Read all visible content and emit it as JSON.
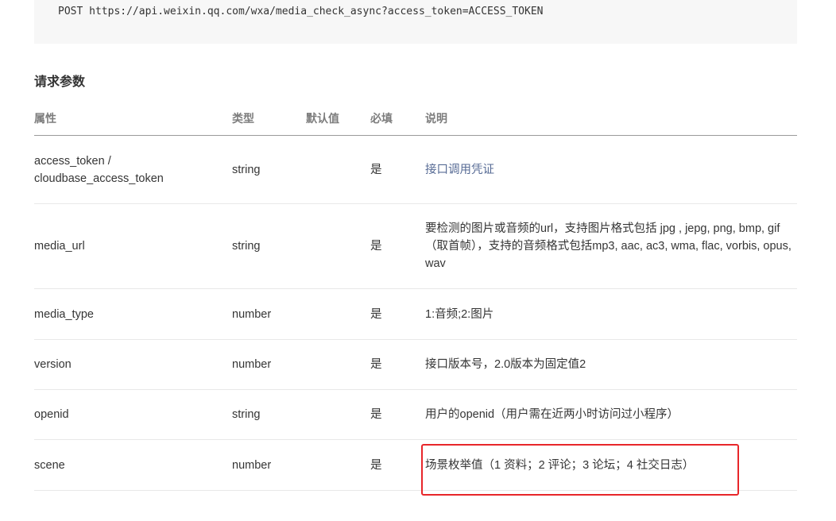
{
  "code": {
    "request_line": "POST https://api.weixin.qq.com/wxa/media_check_async?access_token=ACCESS_TOKEN"
  },
  "section": {
    "title": "请求参数"
  },
  "table": {
    "headers": {
      "name": "属性",
      "type": "类型",
      "default": "默认值",
      "required": "必填",
      "desc": "说明"
    },
    "rows": [
      {
        "name_line1": "access_token /",
        "name_line2": "cloudbase_access_token",
        "type": "string",
        "default": "",
        "required": "是",
        "desc": "接口调用凭证"
      },
      {
        "name": "media_url",
        "type": "string",
        "default": "",
        "required": "是",
        "desc": "要检测的图片或音频的url，支持图片格式包括 jpg , jepg, png, bmp, gif（取首帧），支持的音频格式包括mp3, aac, ac3, wma, flac, vorbis, opus, wav"
      },
      {
        "name": "media_type",
        "type": "number",
        "default": "",
        "required": "是",
        "desc": "1:音频;2:图片"
      },
      {
        "name": "version",
        "type": "number",
        "default": "",
        "required": "是",
        "desc": "接口版本号，2.0版本为固定值2"
      },
      {
        "name": "openid",
        "type": "string",
        "default": "",
        "required": "是",
        "desc": "用户的openid（用户需在近两小时访问过小程序）"
      },
      {
        "name": "scene",
        "type": "number",
        "default": "",
        "required": "是",
        "desc": "场景枚举值（1 资料；2 评论；3 论坛；4 社交日志）"
      }
    ]
  },
  "colors": {
    "link": "#576b95",
    "highlight": "#e8262a",
    "code_bg": "#f7f7f7"
  }
}
